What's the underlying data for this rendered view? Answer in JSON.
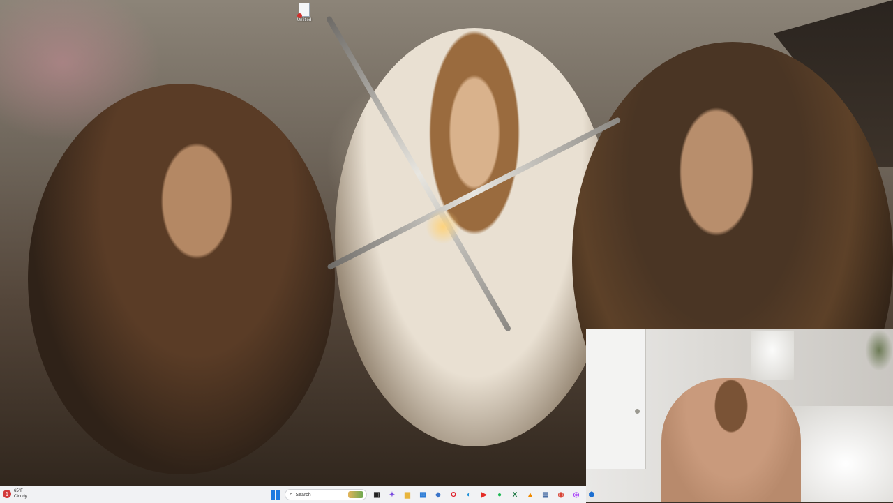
{
  "desktop": {
    "wallpaper": "samurai-swords-wallpaper",
    "icons": [
      {
        "label": "Untitled",
        "icon": "text-document-icon",
        "status": "error"
      }
    ]
  },
  "webcam": {
    "content": "webcam-overlay"
  },
  "taskbar": {
    "weather": {
      "temperature": "65°F",
      "condition": "Cloudy",
      "alert_count": "1",
      "icon": "weather-alert-icon"
    },
    "search": {
      "placeholder": "Search"
    },
    "apps": [
      {
        "name": "task-view",
        "glyph": "▣",
        "color": "#222222"
      },
      {
        "name": "copilot",
        "glyph": "✦",
        "color": "#7b4ce0"
      },
      {
        "name": "file-explorer",
        "glyph": "▆",
        "color": "#e8b53c"
      },
      {
        "name": "store",
        "glyph": "▦",
        "color": "#2a7bd6"
      },
      {
        "name": "photos",
        "glyph": "◆",
        "color": "#3a74c9"
      },
      {
        "name": "opera",
        "glyph": "O",
        "color": "#e0252f"
      },
      {
        "name": "edge",
        "glyph": "◐",
        "color": "#1a8fd8"
      },
      {
        "name": "youtube",
        "glyph": "▶",
        "color": "#e52d27"
      },
      {
        "name": "spotify",
        "glyph": "●",
        "color": "#1db954"
      },
      {
        "name": "excel",
        "glyph": "X",
        "color": "#1f7a45"
      },
      {
        "name": "vlc",
        "glyph": "▲",
        "color": "#f08a00"
      },
      {
        "name": "calculator",
        "glyph": "▤",
        "color": "#4a6fa5"
      },
      {
        "name": "chrome",
        "glyph": "◉",
        "color": "#d94436"
      },
      {
        "name": "messenger",
        "glyph": "◎",
        "color": "#a334fa"
      },
      {
        "name": "security",
        "glyph": "⬢",
        "color": "#1c6fd1"
      }
    ]
  }
}
